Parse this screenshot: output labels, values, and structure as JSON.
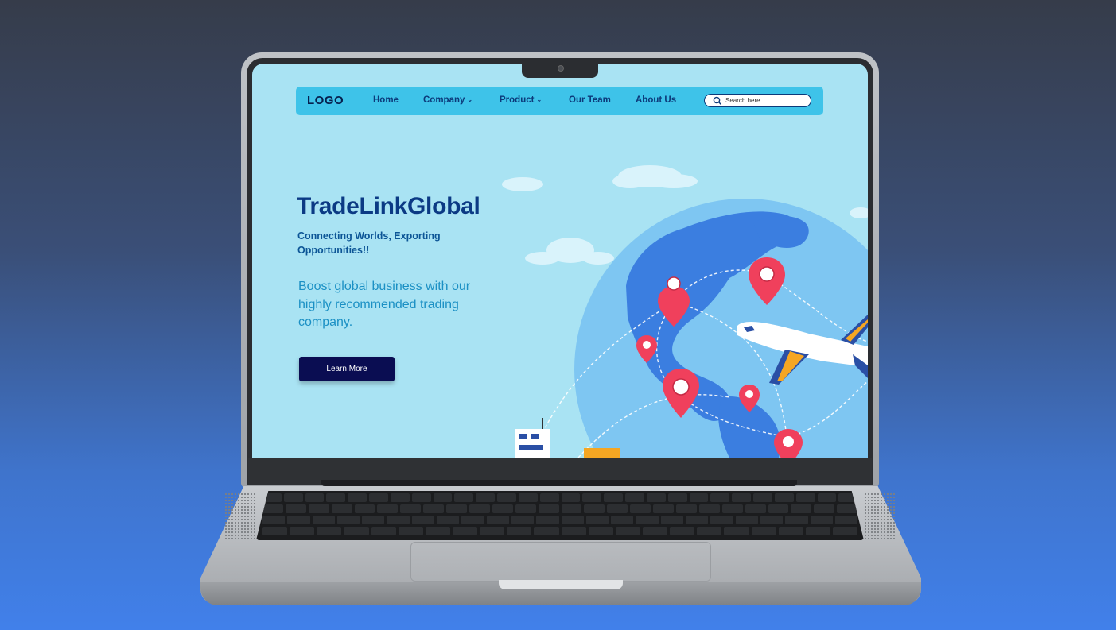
{
  "site": {
    "logo": "LOGO",
    "nav": {
      "home": "Home",
      "company": "Company",
      "product": "Product",
      "our_team": "Our Team",
      "about_us": "About Us"
    },
    "search": {
      "placeholder": "Search here..."
    },
    "hero": {
      "title": "TradeLinkGlobal",
      "subtitle": "Connecting Worlds, Exporting Opportunities!!",
      "description": "Boost global business with our highly recommended trading company.",
      "cta_label": "Learn More"
    }
  },
  "colors": {
    "background_top": "#363c4a",
    "background_bottom": "#4180ea",
    "screen_bg": "#a9e3f3",
    "nav_bg": "#3ec3e9",
    "title": "#0b3a84",
    "cta_bg": "#0a0d52",
    "pin": "#f0405c",
    "globe": "#3b7ee0"
  },
  "icons": {
    "search": "search-icon",
    "dropdown": "chevron-down-icon",
    "pin": "map-pin-icon"
  }
}
